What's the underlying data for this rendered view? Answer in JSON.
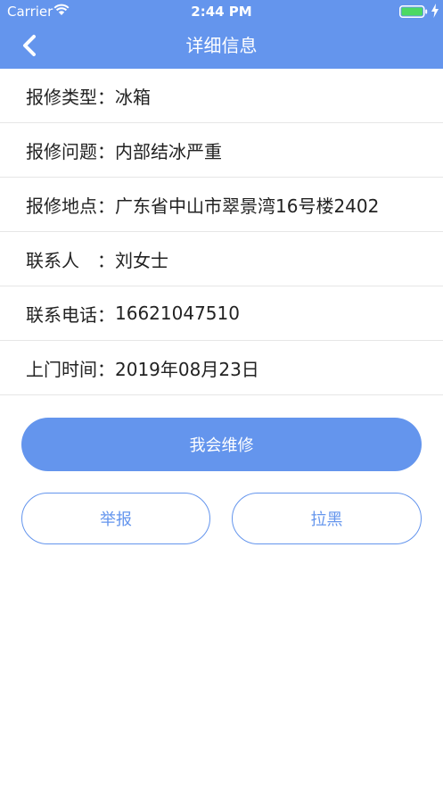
{
  "status_bar": {
    "carrier": "Carrier",
    "time": "2:44 PM"
  },
  "header": {
    "title": "详细信息",
    "back_icon": "chevron-left-icon"
  },
  "details": [
    {
      "label": "报修类型：",
      "value": "冰箱"
    },
    {
      "label": "报修问题：",
      "value": "内部结冰严重"
    },
    {
      "label": "报修地点：",
      "value": "广东省中山市翠景湾16号楼2402"
    },
    {
      "label": "联系人　：",
      "value": "刘女士"
    },
    {
      "label": "联系电话：",
      "value": "16621047510"
    },
    {
      "label": "上门时间：",
      "value": "2019年08月23日"
    }
  ],
  "actions": {
    "repair_label": "我会维修",
    "report_label": "举报",
    "block_label": "拉黑"
  },
  "colors": {
    "accent": "#6495ED",
    "battery": "#4CD964"
  }
}
